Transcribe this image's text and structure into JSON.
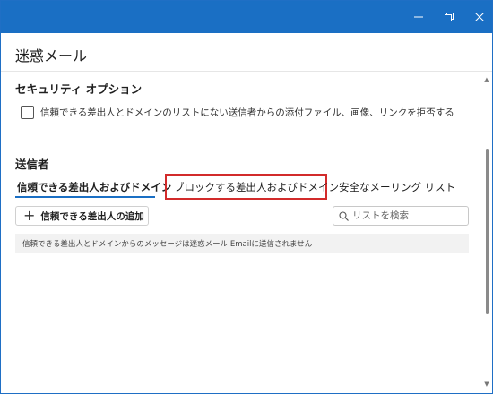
{
  "dialog": {
    "title": "迷惑メール"
  },
  "security": {
    "section_title": "セキュリティ オプション",
    "checkbox_label": "信頼できる差出人とドメインのリストにない送信者からの添付ファイル、画像、リンクを拒否する",
    "checked": false
  },
  "senders": {
    "section_title": "送信者",
    "tabs": [
      {
        "label": "信頼できる差出人およびドメイン",
        "active": true
      },
      {
        "label": "ブロックする差出人およびドメイン",
        "active": false,
        "highlighted": true
      },
      {
        "label": "安全なメーリング リスト",
        "active": false
      }
    ],
    "add_button_label": "信頼できる差出人の追加",
    "search_placeholder": "リストを検索",
    "info_text": "信頼できる差出人とドメインからのメッセージは迷惑メール Emailに送信されません"
  },
  "colors": {
    "titlebar": "#1a6fc4",
    "highlight_box": "#d22b2b",
    "tab_underline": "#1a6fc4"
  },
  "icons": {
    "minimize": "minimize-icon",
    "restore": "restore-icon",
    "close": "close-icon",
    "plus": "plus-icon",
    "search": "search-icon"
  }
}
